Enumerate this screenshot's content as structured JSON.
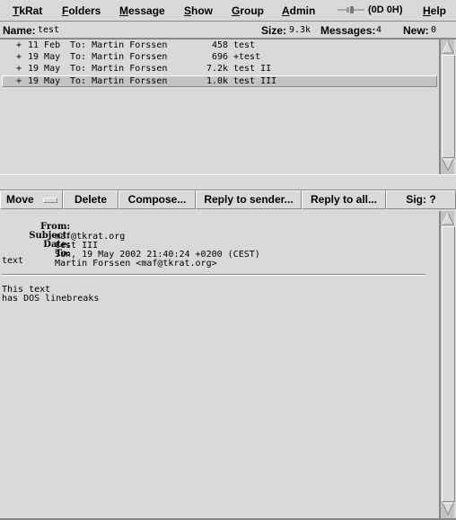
{
  "menubar": {
    "items": [
      {
        "label": "TkRat",
        "underline": "T"
      },
      {
        "label": "Folders",
        "underline": "F"
      },
      {
        "label": "Message",
        "underline": "M"
      },
      {
        "label": "Show",
        "underline": "S"
      },
      {
        "label": "Group",
        "underline": "G"
      },
      {
        "label": "Admin",
        "underline": "A"
      },
      {
        "label": "Help",
        "underline": "H"
      }
    ],
    "connection": {
      "icon": "plug-icon",
      "text": "(0D 0H)"
    }
  },
  "status": {
    "name_label": "Name:",
    "name_value": "test",
    "size_label": "Size:",
    "size_value": "9.3k",
    "messages_label": "Messages:",
    "messages_value": "4",
    "new_label": "New:",
    "new_value": "0"
  },
  "message_list": {
    "rows": [
      {
        "flag": "+",
        "date": "11 Feb",
        "to": "To: Martin Forssen",
        "size": "458",
        "subject": "test",
        "selected": false
      },
      {
        "flag": "+",
        "date": "19 May",
        "to": "To: Martin Forssen",
        "size": "696",
        "subject": "+test",
        "selected": false
      },
      {
        "flag": "+",
        "date": "19 May",
        "to": "To: Martin Forssen",
        "size": "7.2k",
        "subject": "test II",
        "selected": false
      },
      {
        "flag": "+",
        "date": "19 May",
        "to": "To: Martin Forssen",
        "size": "1.0k",
        "subject": "test III",
        "selected": true
      }
    ]
  },
  "toolbar": {
    "move_label": "Move",
    "delete_label": "Delete",
    "compose_label": "Compose...",
    "reply_sender_label": "Reply to sender...",
    "reply_all_label": "Reply to all...",
    "sig_label": "Sig: ?"
  },
  "viewer": {
    "headers": [
      {
        "key": "From:",
        "value": "maf@tkrat.org"
      },
      {
        "key": "Subject:",
        "value": "test III"
      },
      {
        "key": "Date:",
        "value": "Sun, 19 May 2002 21:40:24 +0200 (CEST)"
      },
      {
        "key": "To:",
        "value": "Martin Forssen <maf@tkrat.org>"
      }
    ],
    "body_top": "text",
    "body_lines": [
      "This text",
      "has DOS linebreaks"
    ]
  },
  "colors": {
    "background": "#d9d9d9",
    "selected_row": "#c3c3c3",
    "shadow": "#888888",
    "highlight": "#ffffff"
  }
}
